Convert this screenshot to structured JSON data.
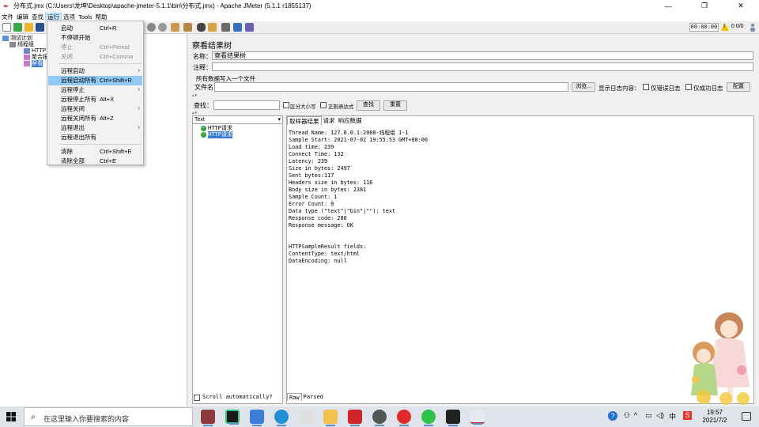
{
  "window": {
    "title": "分布式.jmx (C:\\Users\\龙坤\\Desktop\\apache-jmeter-5.1.1\\bin\\分布式.jmx) - Apache JMeter (5.1.1 r1855137)",
    "minimize": "—",
    "maximize": "❐",
    "close": "✕"
  },
  "menubar": {
    "items": [
      "文件",
      "编辑",
      "查找",
      "运行",
      "选项",
      "Tools",
      "帮助"
    ]
  },
  "toolbar": {
    "timer": "00:00:00",
    "warn_mark": "!",
    "count": "0 0/0"
  },
  "tree": {
    "items": [
      {
        "label": "测试计划"
      },
      {
        "label": "线程组"
      },
      {
        "label": "HTTP"
      },
      {
        "label": "聚合报"
      },
      {
        "label": "察看"
      }
    ]
  },
  "context_menu": {
    "items": [
      {
        "label": "启动",
        "shortcut": "Ctrl+R",
        "submenu": false,
        "disabled": false
      },
      {
        "label": "不停顿开始",
        "shortcut": "",
        "submenu": false,
        "disabled": false
      },
      {
        "label": "停止",
        "shortcut": "Ctrl+Period",
        "submenu": false,
        "disabled": true
      },
      {
        "label": "关闭",
        "shortcut": "Ctrl+Comma",
        "submenu": false,
        "disabled": true
      },
      {
        "label": "远程启动",
        "shortcut": "",
        "submenu": true,
        "disabled": false
      },
      {
        "label": "远程启动所有",
        "shortcut": "Ctrl+Shift+R",
        "submenu": false,
        "disabled": false,
        "highlighted": true
      },
      {
        "label": "远程停止",
        "shortcut": "",
        "submenu": true,
        "disabled": false
      },
      {
        "label": "远程停止所有",
        "shortcut": "Alt+X",
        "submenu": false,
        "disabled": false
      },
      {
        "label": "远程关闭",
        "shortcut": "",
        "submenu": true,
        "disabled": false
      },
      {
        "label": "远程关闭所有",
        "shortcut": "Alt+Z",
        "submenu": false,
        "disabled": false
      },
      {
        "label": "远程退出",
        "shortcut": "",
        "submenu": true,
        "disabled": false
      },
      {
        "label": "远程退出所有",
        "shortcut": "",
        "submenu": false,
        "disabled": false
      },
      {
        "label": "清除",
        "shortcut": "Ctrl+Shift+E",
        "submenu": false,
        "disabled": false
      },
      {
        "label": "清除全部",
        "shortcut": "Ctrl+E",
        "submenu": false,
        "disabled": false
      }
    ]
  },
  "panel": {
    "title": "察看结果树",
    "name_label": "名称：",
    "name_value": "察看结果树",
    "comment_label": "注释：",
    "comment_value": "",
    "write_all_label": "所有数据写入一个文件",
    "filename_label": "文件名",
    "filename_value": "",
    "browse_button": "浏览...",
    "log_content_label": "显示日志内容：",
    "errors_only_label": "仅错误日志",
    "success_only_label": "仅成功日志",
    "configure_button": "配置",
    "search_label": "查找：",
    "search_value": "",
    "case_label": "区分大小写",
    "regex_label": "正则表达式",
    "find_button": "查找",
    "reset_button": "重置",
    "renderer": "Text",
    "renderer_arrow": "▾",
    "results": [
      {
        "label": "HTTP请求"
      },
      {
        "label": "HTTP请求"
      }
    ],
    "scroll_auto": "Scroll automatically?",
    "tabs": [
      "取样器结果",
      "请求",
      "响应数据"
    ],
    "bottom_tabs": [
      "Raw",
      "Parsed"
    ],
    "detail_lines": [
      "Thread Name: 127.0.0.1:2088-线程组 1-1",
      "Sample Start: 2021-07-02 19:55:53 GMT+08:00",
      "Load time: 239",
      "Connect Time: 132",
      "Latency: 239",
      "Size in bytes: 2497",
      "Sent bytes:117",
      "Headers size in bytes: 116",
      "Body size in bytes: 2381",
      "Sample Count: 1",
      "Error Count: 0",
      "Data type (\"text\"|\"bin\"|\"\"): text",
      "Response code: 200",
      "Response message: OK",
      "",
      "",
      "HTTPSampleResult fields:",
      "ContentType: text/html",
      "DataEncoding: null"
    ]
  },
  "taskbar": {
    "search_placeholder": "在这里输入你要搜索的内容",
    "search_icon": "⌕",
    "tray_help": "?",
    "tray_lang": "中",
    "tray_ime": "S",
    "time": "19:57",
    "date": "2021/7/2"
  },
  "colors": {
    "selection": "#3d7bd5",
    "menu_highlight": "#91c9f7",
    "menu_active": "#cce8ff",
    "ok_green": "#2e9e3c"
  }
}
